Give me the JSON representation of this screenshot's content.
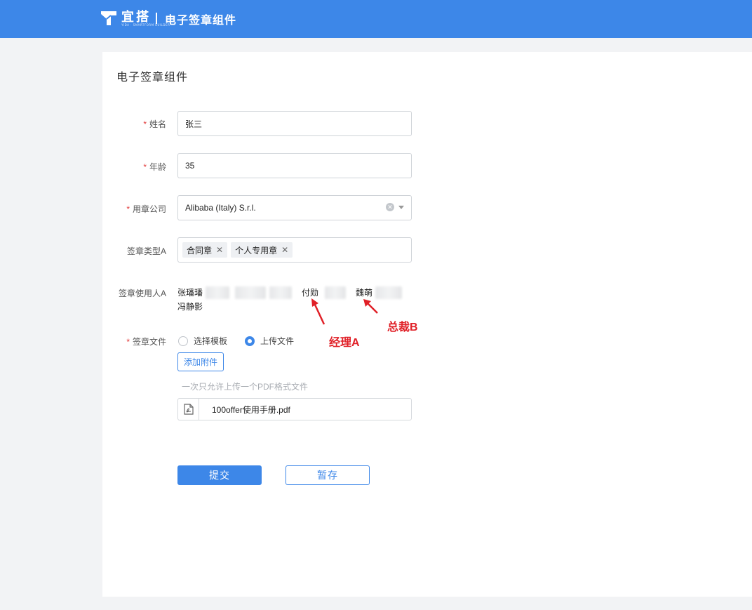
{
  "header": {
    "logo_text": "宜搭",
    "logo_subtext": "YIDA · SMARTFORM BUILDER",
    "app_title": "电子签章组件",
    "brand_color": "#3d87e8"
  },
  "page": {
    "title": "电子签章组件"
  },
  "form": {
    "name": {
      "label": "姓名",
      "value": "张三"
    },
    "age": {
      "label": "年龄",
      "value": "35"
    },
    "company": {
      "label": "用章公司",
      "value": "Alibaba (Italy) S.r.l."
    },
    "seal_type": {
      "label": "签章类型A",
      "tags": [
        "合同章",
        "个人专用章"
      ],
      "remove_glyph": "✕"
    },
    "seal_users": {
      "label": "签章使用人A",
      "people": [
        "张璠璠",
        "冯静影",
        "付勋",
        "魏萌"
      ]
    },
    "seal_file": {
      "label": "签章文件",
      "options": [
        "选择模板",
        "上传文件"
      ],
      "selected": "上传文件",
      "attach_button": "添加附件",
      "hint": "一次只允许上传一个PDF格式文件",
      "file_name": "100offer使用手册.pdf"
    },
    "required_mark": "*"
  },
  "annotations": {
    "manager": "经理A",
    "president": "总裁B",
    "color": "#e02027"
  },
  "actions": {
    "submit": "提交",
    "save_draft": "暂存"
  }
}
